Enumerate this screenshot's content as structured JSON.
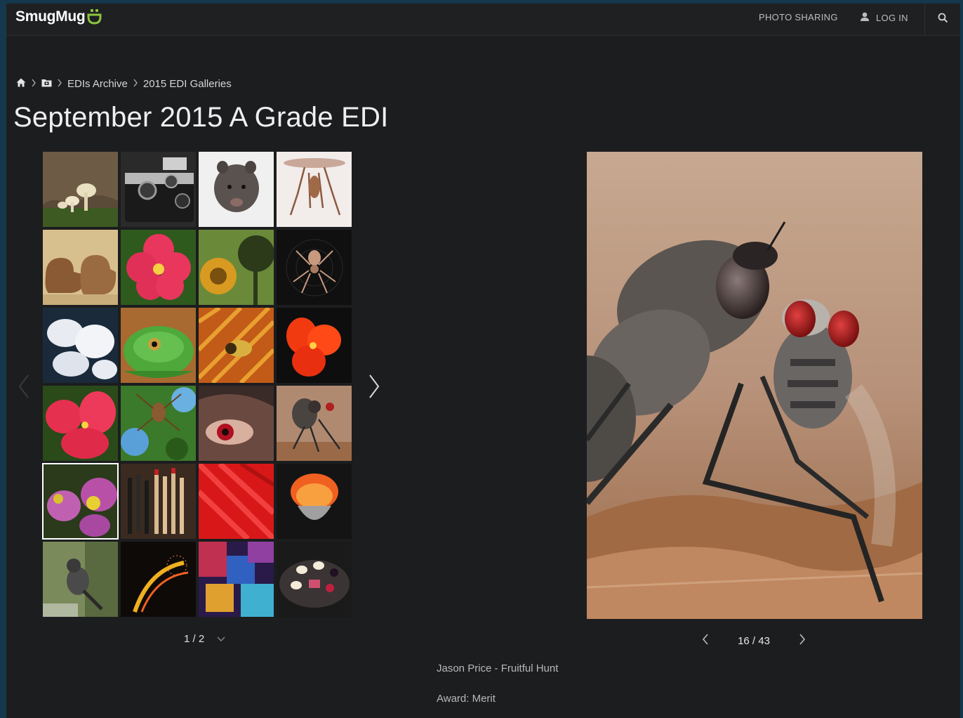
{
  "header": {
    "brand": "SmugMug",
    "photo_sharing": "PHOTO SHARING",
    "login": "LOG IN",
    "logo_color": "#8bc53f"
  },
  "breadcrumb": {
    "items": [
      "EDIs Archive",
      "2015 EDI Galleries"
    ]
  },
  "gallery": {
    "title": "September 2015 A Grade EDI",
    "pager_label": "1 / 2",
    "thumbnails": [
      "mushrooms",
      "camera",
      "wombat",
      "insect-on-white",
      "baby-boots",
      "pink-flower",
      "sunflower-silhouette",
      "spider-web",
      "white-mushrooms",
      "green-frog",
      "golden-wasp",
      "red-flower",
      "pink-hibiscus",
      "spider-leaves",
      "eye-closeup",
      "robber-fly",
      "purple-hellebore",
      "matches",
      "red-petal",
      "orange-feather",
      "grey-bird",
      "light-swirl",
      "abstract-colors",
      "dessert-plate"
    ],
    "selected_index": 16
  },
  "viewer": {
    "counter": "16 / 43",
    "caption": "Jason Price - Fruitful Hunt",
    "award": "Award: Merit"
  }
}
